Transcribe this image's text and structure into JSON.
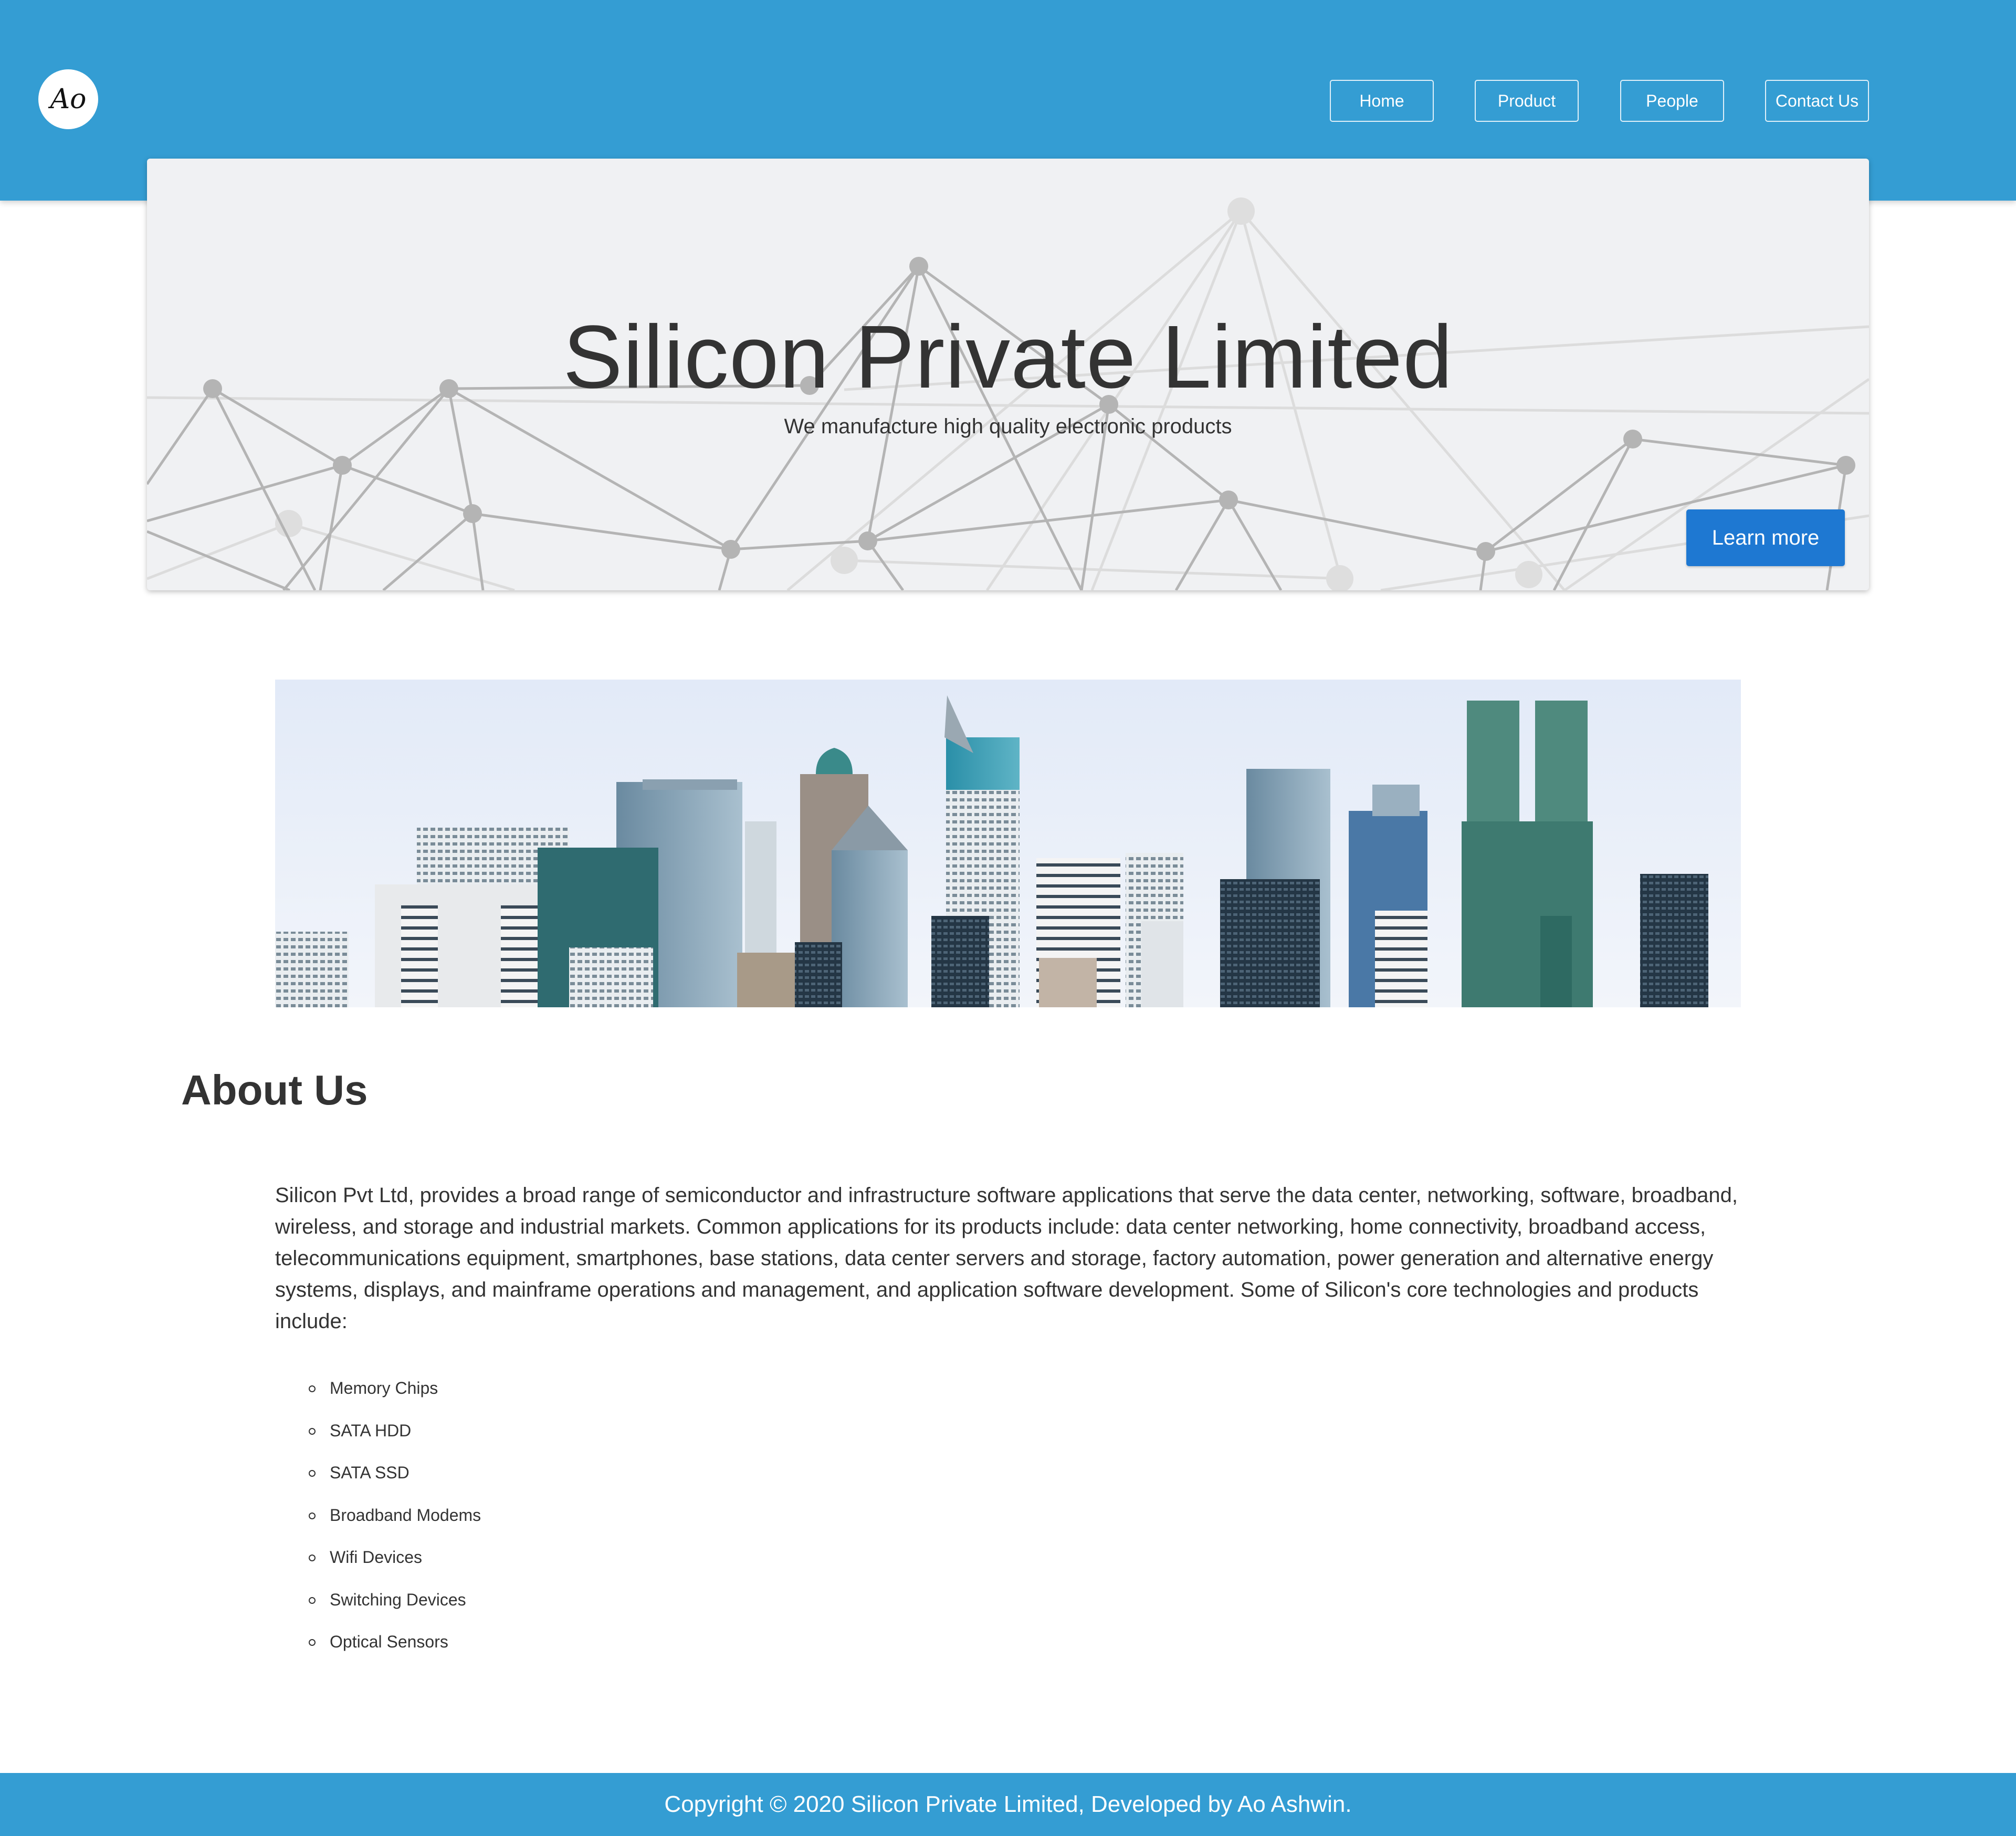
{
  "header": {
    "logo_text": "Ao",
    "nav": {
      "home": "Home",
      "product": "Product",
      "people": "People",
      "contact": "Contact Us"
    }
  },
  "hero": {
    "title": "Silicon Private Limited",
    "subtitle": "We manufacture high quality electronic products",
    "cta_label": "Learn more"
  },
  "about": {
    "title": "About Us",
    "paragraph": "Silicon Pvt Ltd, provides a broad range of semiconductor and infrastructure software applications that serve the data center, networking, software, broadband, wireless, and storage and industrial markets. Common applications for its products include: data center networking, home connectivity, broadband access, telecommunications equipment, smartphones, base stations, data center servers and storage, factory automation, power generation and alternative energy systems, displays, and mainframe operations and management, and application software development. Some of Silicon's core technologies and products include:",
    "products": [
      "Memory Chips",
      "SATA HDD",
      "SATA SSD",
      "Broadband Modems",
      "Wifi Devices",
      "Switching Devices",
      "Optical Sensors"
    ]
  },
  "footer": {
    "text": "Copyright © 2020 Silicon Private Limited, Developed by Ao Ashwin."
  },
  "colors": {
    "brand_blue": "#349dd3",
    "button_blue": "#1e78d2",
    "hero_bg": "#f0f1f3"
  }
}
